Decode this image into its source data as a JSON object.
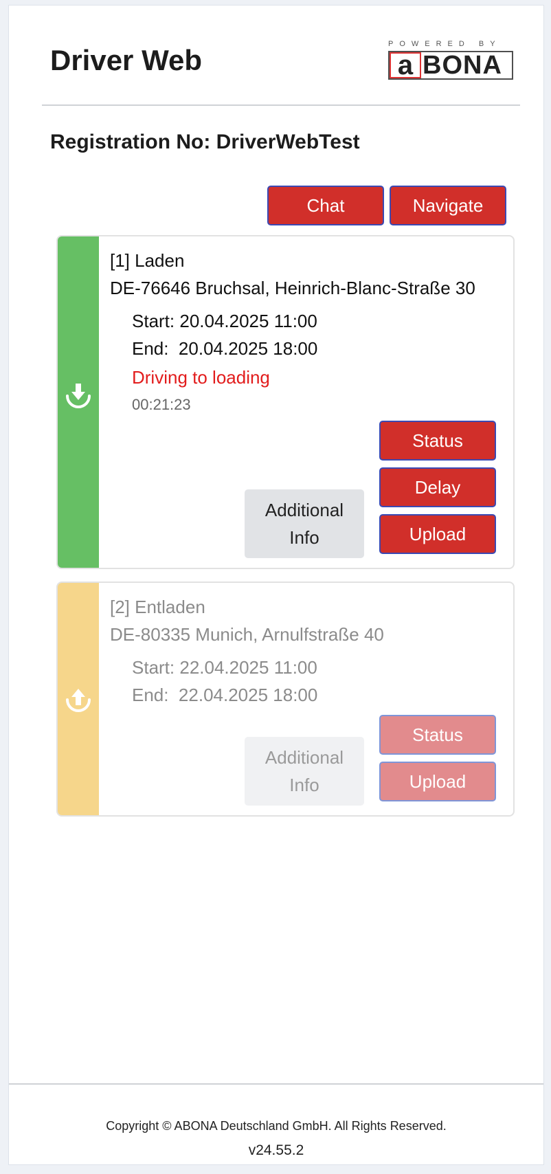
{
  "header": {
    "title": "Driver Web",
    "logo_tagline": "POWERED BY",
    "logo_text": "ABONA"
  },
  "registration": {
    "label": "Registration No: DriverWebTest"
  },
  "actions": {
    "chat": "Chat",
    "navigate": "Navigate"
  },
  "stops": [
    {
      "title": "[1] Laden",
      "address": "DE-76646 Bruchsal, Heinrich-Blanc-Straße 30",
      "start": "Start: 20.04.2025 11:00",
      "end": "End:  20.04.2025 18:00",
      "status": "Driving to loading",
      "timer": "00:21:23",
      "info_label_1": "Additional",
      "info_label_2": "Info",
      "buttons": {
        "status": "Status",
        "delay": "Delay",
        "upload": "Upload"
      },
      "strip_color": "#66bf64",
      "icon": "download-icon"
    },
    {
      "title": "[2] Entladen",
      "address": "DE-80335 Munich, Arnulfstraße 40",
      "start": "Start: 22.04.2025 11:00",
      "end": "End:  22.04.2025 18:00",
      "info_label_1": "Additional",
      "info_label_2": "Info",
      "buttons": {
        "status": "Status",
        "upload": "Upload"
      },
      "strip_color": "#f6d68b",
      "icon": "upload-icon"
    }
  ],
  "footer": {
    "copyright": "Copyright © ABONA Deutschland GmbH. All Rights Reserved.",
    "version": "v24.55.2"
  },
  "colors": {
    "primary_button": "#d12f2a",
    "status_text": "#e21c1c"
  }
}
